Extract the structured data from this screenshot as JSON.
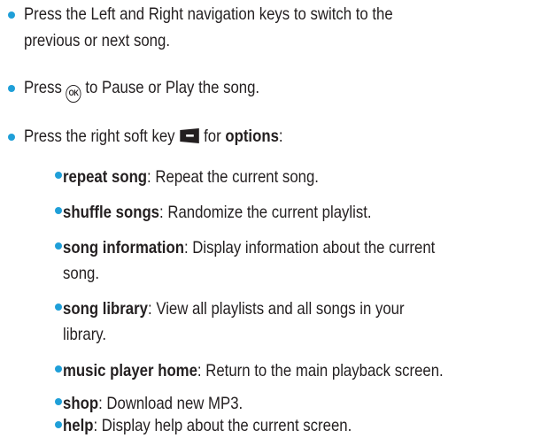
{
  "bullet_color": "#1f9fd8",
  "item1": {
    "line1": "Press the Left and Right navigation keys to switch to the",
    "line2": "previous or next song."
  },
  "item2": {
    "before": "Press ",
    "icon": "ok-key-icon",
    "icon_label": "OK",
    "after": " to Pause or Play the song."
  },
  "item3": {
    "before": "Press the right soft key ",
    "icon": "right-softkey-icon",
    "middle": " for ",
    "term": "options",
    "after": ":"
  },
  "options": [
    {
      "term": "repeat song",
      "desc": ": Repeat the current song."
    },
    {
      "term": "shuffle songs",
      "desc": ": Randomize the current playlist."
    },
    {
      "term": "song information",
      "desc": ": Display information about the current",
      "desc2": "song."
    },
    {
      "term": "song library",
      "desc": ": View all playlists and all songs in your",
      "desc2": "library."
    },
    {
      "term": "music player home",
      "desc": ": Return to the main playback screen."
    },
    {
      "term": "shop",
      "desc": ": Download new MP3."
    },
    {
      "term": "help",
      "desc": ": Display help about the current screen."
    }
  ]
}
